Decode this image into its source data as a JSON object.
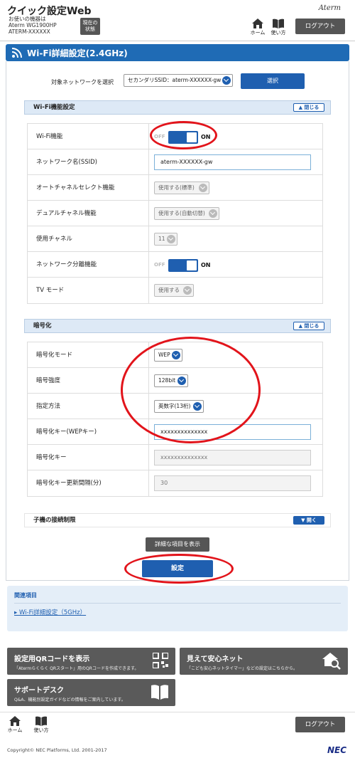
{
  "header": {
    "app_title": "クイック設定Web",
    "device_line1": "お使いの機器は",
    "device_line2": "Aterm WG1900HP",
    "device_line3": "ATERM-XXXXXX",
    "status_button": "現在の\n状態",
    "brand": "Aterm",
    "home_label": "ホーム",
    "help_label": "使い方",
    "logout_button": "ログアウト"
  },
  "page_title": "Wi-Fi詳細設定(2.4GHz)",
  "network_select": {
    "label": "対象ネットワークを選択",
    "value": "セカンダリSSID：aterm-XXXXXX-gw",
    "button": "選択"
  },
  "sections": {
    "wifi": {
      "title": "Wi-Fi機能設定",
      "toggle": "閉じる",
      "rows": [
        {
          "label": "Wi-Fi機能",
          "off": "OFF",
          "on": "ON"
        },
        {
          "label": "ネットワーク名(SSID)",
          "value": "aterm-XXXXXX-gw"
        },
        {
          "label": "オートチャネルセレクト機能",
          "value": "使用する(標準)"
        },
        {
          "label": "デュアルチャネル機能",
          "value": "使用する(自動切替)"
        },
        {
          "label": "使用チャネル",
          "value": "11"
        },
        {
          "label": "ネットワーク分離機能",
          "off": "OFF",
          "on": "ON"
        },
        {
          "label": "TV モード",
          "value": "使用する"
        }
      ]
    },
    "encryption": {
      "title": "暗号化",
      "toggle": "閉じる",
      "rows": [
        {
          "label": "暗号化モード",
          "value": "WEP"
        },
        {
          "label": "暗号強度",
          "value": "128bit"
        },
        {
          "label": "指定方法",
          "value": "英数字(13桁)"
        },
        {
          "label": "暗号化キー(WEPキー)",
          "value": "xxxxxxxxxxxxxx"
        },
        {
          "label": "暗号化キー",
          "value": "xxxxxxxxxxxxxx"
        },
        {
          "label": "暗号化キー更新間隔(分)",
          "value": "30"
        }
      ]
    },
    "child": {
      "title": "子機の接続制限",
      "toggle": "開く"
    }
  },
  "detail_button": "詳細な項目を表示",
  "submit_button": "設定",
  "related": {
    "heading": "関連項目",
    "link": "Wi-Fi詳細設定（5GHz）"
  },
  "cards": {
    "qr": {
      "title": "設定用QRコードを表示",
      "desc": "「Atermらくらく QRスタート」用のQRコードを作成できます。"
    },
    "safety": {
      "title": "見えて安心ネット",
      "desc": "「こども安心ネットタイマー」などの設定はこちらから。"
    },
    "support": {
      "title": "サポートデスク",
      "desc": "Q&A、機能別設定ガイドなどの情報をご案内しています。"
    }
  },
  "footer": {
    "home_label": "ホーム",
    "help_label": "使い方",
    "logout_button": "ログアウト",
    "copyright": "Copyright© NEC Platforms, Ltd. 2001-2017",
    "nec_logo": "NEC"
  },
  "colors": {
    "accent": "#1f5fb0",
    "highlight_ring": "#e2141b",
    "dark_button": "#555555"
  }
}
